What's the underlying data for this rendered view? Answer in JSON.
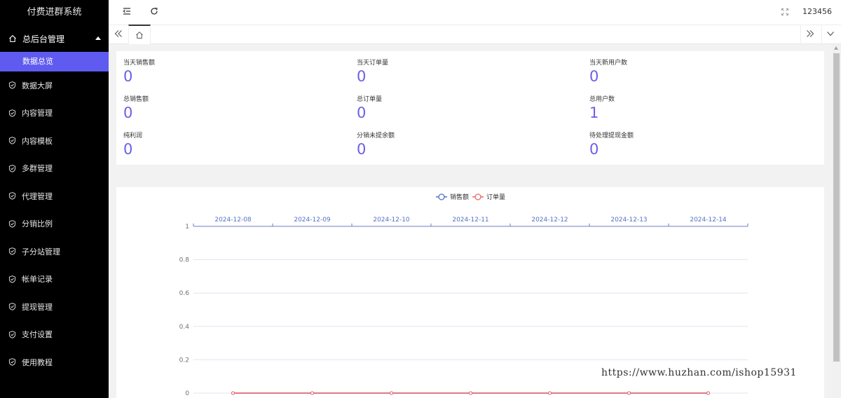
{
  "app": {
    "title": "付费进群系统",
    "username": "123456"
  },
  "sidebar": {
    "group_label": "总后台管理",
    "active_item": "数据总览",
    "items": [
      {
        "label": "数据大屏"
      },
      {
        "label": "内容管理"
      },
      {
        "label": "内容模板"
      },
      {
        "label": "多群管理"
      },
      {
        "label": "代理管理"
      },
      {
        "label": "分销比例"
      },
      {
        "label": "子分站管理"
      },
      {
        "label": "帐单记录"
      },
      {
        "label": "提现管理"
      },
      {
        "label": "支付设置"
      },
      {
        "label": "使用教程"
      }
    ]
  },
  "topbar": {
    "icons": [
      "menu-fold-icon",
      "refresh-icon",
      "fullscreen-icon"
    ]
  },
  "tabs": {
    "icons": [
      "double-chevron-left-icon",
      "home-icon",
      "double-chevron-right-icon",
      "chevron-down-icon"
    ]
  },
  "stats": [
    {
      "label": "当天销售额",
      "value": "0"
    },
    {
      "label": "当天订单量",
      "value": "0"
    },
    {
      "label": "当天新用户数",
      "value": "0"
    },
    {
      "label": "总销售额",
      "value": "0"
    },
    {
      "label": "总订单量",
      "value": "0"
    },
    {
      "label": "总用户数",
      "value": "1"
    },
    {
      "label": "纯利润",
      "value": "0"
    },
    {
      "label": "分销未提余额",
      "value": "0"
    },
    {
      "label": "待处理提现金额",
      "value": "0"
    }
  ],
  "colors": {
    "accent": "#5f5bf0",
    "value": "#6a5fe6",
    "series_sales": "#5470c6",
    "series_orders": "#ee6666"
  },
  "chart_data": {
    "type": "line",
    "x": [
      "2024-12-08",
      "2024-12-09",
      "2024-12-10",
      "2024-12-11",
      "2024-12-12",
      "2024-12-13",
      "2024-12-14"
    ],
    "x_axis_position": "top",
    "series": [
      {
        "name": "销售额",
        "values": [
          0,
          0,
          0,
          0,
          0,
          0,
          0
        ]
      },
      {
        "name": "订单量",
        "values": [
          0,
          0,
          0,
          0,
          0,
          0,
          0
        ]
      }
    ],
    "yticks": [
      "1",
      "0.8",
      "0.6",
      "0.4",
      "0.2",
      "0"
    ],
    "ylim": [
      0,
      1
    ],
    "grid": true,
    "legend": "top-center"
  },
  "watermark": "https://www.huzhan.com/ishop15931"
}
